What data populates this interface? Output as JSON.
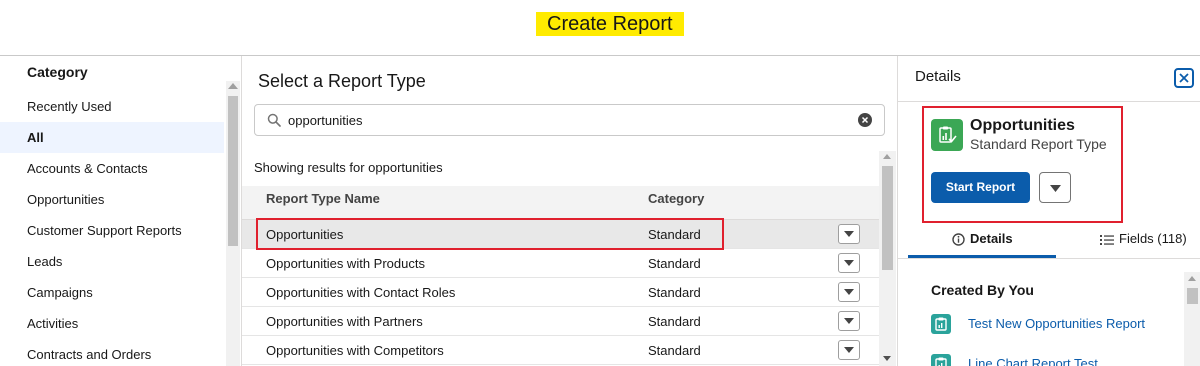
{
  "header": {
    "title": "Create Report",
    "highlight_color": "#ffeb00"
  },
  "sidebar": {
    "heading": "Category",
    "items": [
      {
        "label": "Recently Used"
      },
      {
        "label": "All",
        "selected": true
      },
      {
        "label": "Accounts & Contacts"
      },
      {
        "label": "Opportunities"
      },
      {
        "label": "Customer Support Reports"
      },
      {
        "label": "Leads"
      },
      {
        "label": "Campaigns"
      },
      {
        "label": "Activities"
      },
      {
        "label": "Contracts and Orders"
      }
    ]
  },
  "main": {
    "title": "Select a Report Type",
    "search": {
      "value": "opportunities",
      "placeholder": ""
    },
    "results_label": "Showing results for opportunities",
    "columns": [
      "Report Type Name",
      "Category"
    ],
    "rows": [
      {
        "name": "Opportunities",
        "category": "Standard",
        "selected": true
      },
      {
        "name": "Opportunities with Products",
        "category": "Standard"
      },
      {
        "name": "Opportunities with Contact Roles",
        "category": "Standard"
      },
      {
        "name": "Opportunities with Partners",
        "category": "Standard"
      },
      {
        "name": "Opportunities with Competitors",
        "category": "Standard"
      }
    ]
  },
  "details": {
    "title": "Details",
    "report_type": {
      "name": "Opportunities",
      "type": "Standard Report Type",
      "icon": "report-type-icon"
    },
    "start_button": "Start Report",
    "tabs": [
      {
        "label": "Details",
        "icon": "info-icon",
        "active": true
      },
      {
        "label": "Fields (118)",
        "icon": "list-icon"
      }
    ],
    "created_heading": "Created By You",
    "reports": [
      {
        "label": "Test New Opportunities Report"
      },
      {
        "label": "Line Chart Report Test"
      }
    ]
  },
  "colors": {
    "brand": "#0b5cab",
    "annotation_box": "#e0202e",
    "report_type_icon": "#3ba755",
    "report_link_icon": "#2aa39b"
  }
}
